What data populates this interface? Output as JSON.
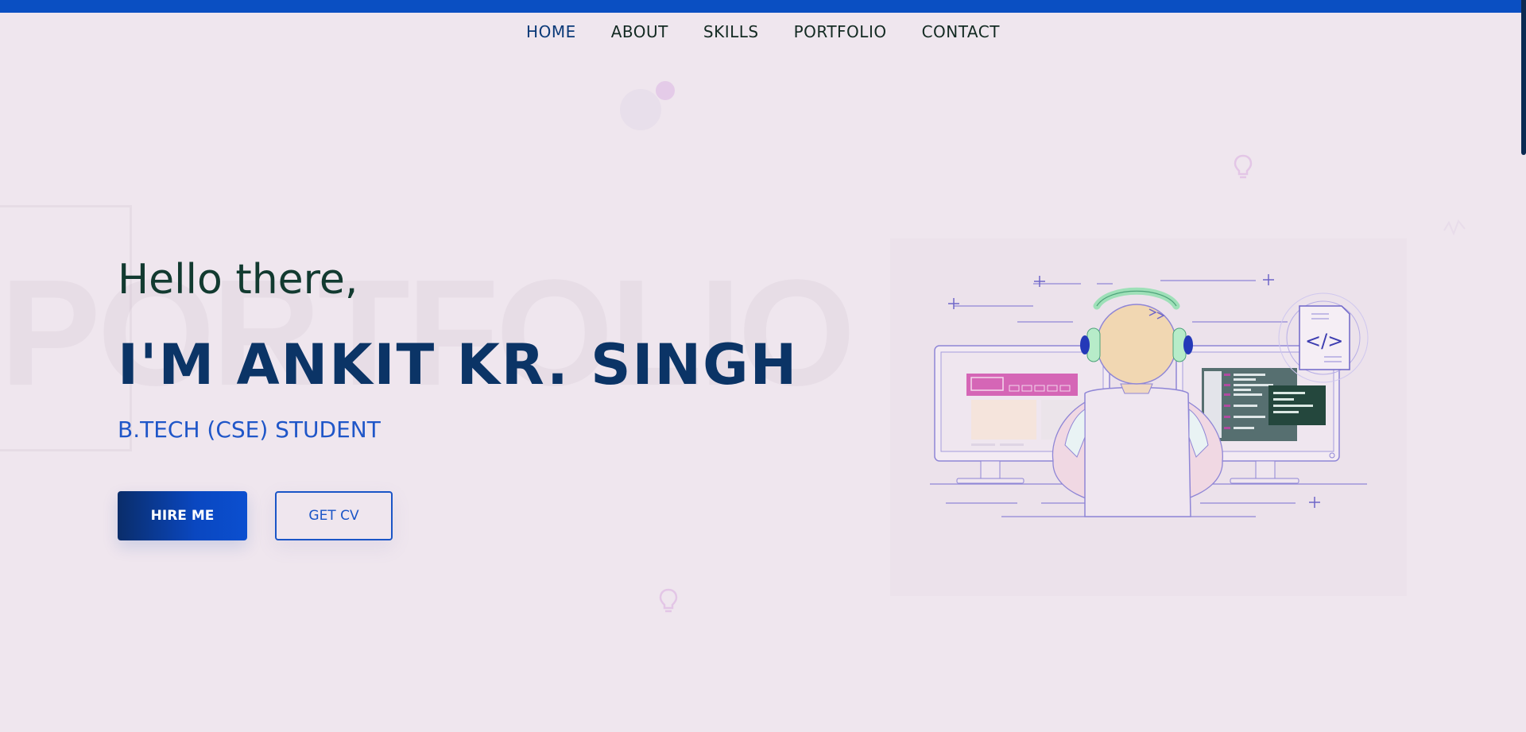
{
  "nav": {
    "items": [
      {
        "label": "HOME",
        "active": true
      },
      {
        "label": "ABOUT",
        "active": false
      },
      {
        "label": "SKILLS",
        "active": false
      },
      {
        "label": "PORTFOLIO",
        "active": false
      },
      {
        "label": "CONTACT",
        "active": false
      }
    ]
  },
  "hero": {
    "greeting": "Hello there,",
    "name": "I'M ANKIT KR. SINGH",
    "subtitle": "B.TECH (CSE) STUDENT",
    "watermark": "PORTFOLIO",
    "hire_button": "HIRE ME",
    "cv_button": "GET CV",
    "code_tag": "</>"
  },
  "colors": {
    "accent": "#0a4fc2",
    "heading": "#0b3466",
    "subtitle": "#1f56c8",
    "background": "#efe6ee"
  },
  "icons": [
    "lightbulb-icon",
    "code-file-icon",
    "developer-illustration"
  ]
}
